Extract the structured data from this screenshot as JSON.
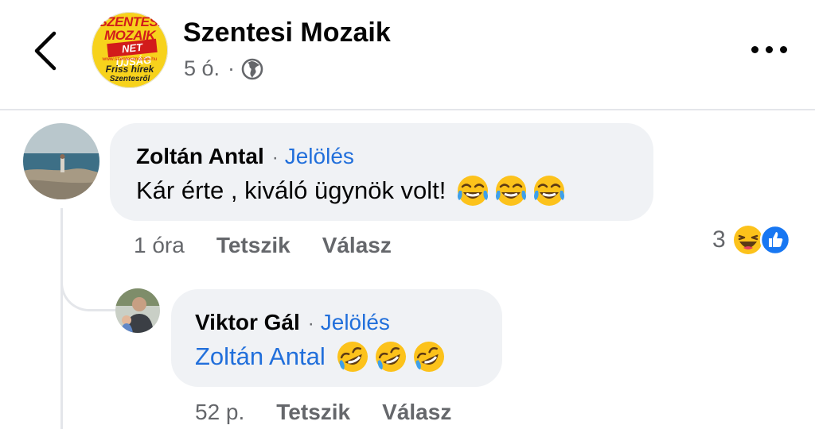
{
  "header": {
    "page_name": "Szentesi Mozaik",
    "post_age": "5 ó.",
    "separator": "·",
    "avatar_logo": {
      "line1": "SZENTESI",
      "line2": "MOZAIK",
      "line3": "NET ÚJSÁG",
      "line4": "www.szentesimozaik.hu",
      "line5": "Friss hírek",
      "line6": "Szentesről"
    },
    "icons": {
      "back": "chevron-left-icon",
      "audience": "globe-icon",
      "more": "more-horizontal-icon"
    }
  },
  "comments": [
    {
      "author": "Zoltán Antal",
      "separator": "·",
      "tag_label": "Jelölés",
      "text": "Kár érte , kiváló ügynök volt!",
      "emojis": [
        "face-with-tears-of-joy",
        "face-with-tears-of-joy",
        "face-with-tears-of-joy"
      ],
      "time": "1 óra",
      "like_label": "Tetszik",
      "reply_label": "Válasz",
      "reaction_count": "3",
      "reaction_icons": [
        "haha-reaction-icon",
        "like-reaction-icon"
      ]
    },
    {
      "author": "Viktor Gál",
      "separator": "·",
      "tag_label": "Jelölés",
      "mention": "Zoltán Antal",
      "emojis": [
        "rolling-on-the-floor-laughing",
        "rolling-on-the-floor-laughing",
        "rolling-on-the-floor-laughing"
      ],
      "time": "52 p.",
      "like_label": "Tetszik",
      "reply_label": "Válasz"
    }
  ],
  "colors": {
    "link_blue": "#216fdb",
    "bubble_bg": "#f0f2f5",
    "secondary_text": "#65676b",
    "like_blue": "#1877f2",
    "emoji_yellow": "#fcc21b"
  }
}
